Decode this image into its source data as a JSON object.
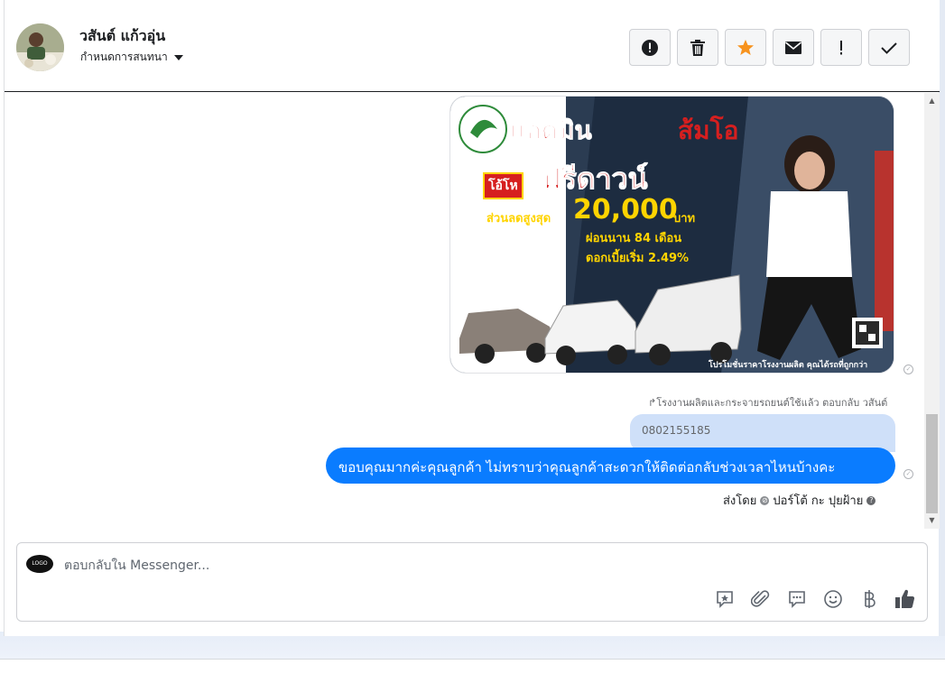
{
  "header": {
    "contact_name": "วสันต์ แก้วอุ่น",
    "assign_label": "กำหนดการสนทนา",
    "toolbar": [
      {
        "name": "spam",
        "icon": "alert-circle-icon"
      },
      {
        "name": "delete",
        "icon": "trash-icon"
      },
      {
        "name": "star",
        "icon": "star-icon"
      },
      {
        "name": "mark-unread",
        "icon": "envelope-icon"
      },
      {
        "name": "follow-up",
        "icon": "exclamation-icon"
      },
      {
        "name": "done",
        "icon": "check-icon"
      }
    ],
    "star_color": "#f7931e"
  },
  "conversation": {
    "ad_image": {
      "headline_1": "แอดมิน",
      "headline_2": "ส้มโอ",
      "tag": "โอ้โห",
      "headline_3": "ฟรีดาวน์",
      "discount_label": "ส่วนลดสูงสุด",
      "discount_amount": "20,000",
      "discount_unit": "บาท",
      "installment": "ผ่อนนาน 84 เดือน",
      "interest": "ดอกเบี้ยเริ่ม 2.49%",
      "footer": "โปรโมชั่นราคาโรงงานผลิต คุณได้รถที่ถูกกว่า"
    },
    "reply_note": "โรงงานผลิตและกระจายรถยนต์ใช้แล้ว ตอบกลับ วสันต์",
    "quoted_text": "0802155185",
    "message": "ขอบคุณมากค่ะคุณลูกค้า ไม่ทราบว่าคุณลูกค้าสะดวกให้ติดต่อกลับช่วงเวลาไหนบ้างคะ",
    "sent_by": "ส่งโดย",
    "sender": "ปอร์โต้ กะ ปุยฝ้าย",
    "bubble_color": "#0a7cff"
  },
  "composer": {
    "placeholder": "ตอบกลับใน Messenger...",
    "tools": [
      "saved-reply-icon",
      "paperclip-icon",
      "chat-bubble-icon",
      "smiley-icon",
      "baht-icon",
      "thumbs-up-icon"
    ]
  }
}
